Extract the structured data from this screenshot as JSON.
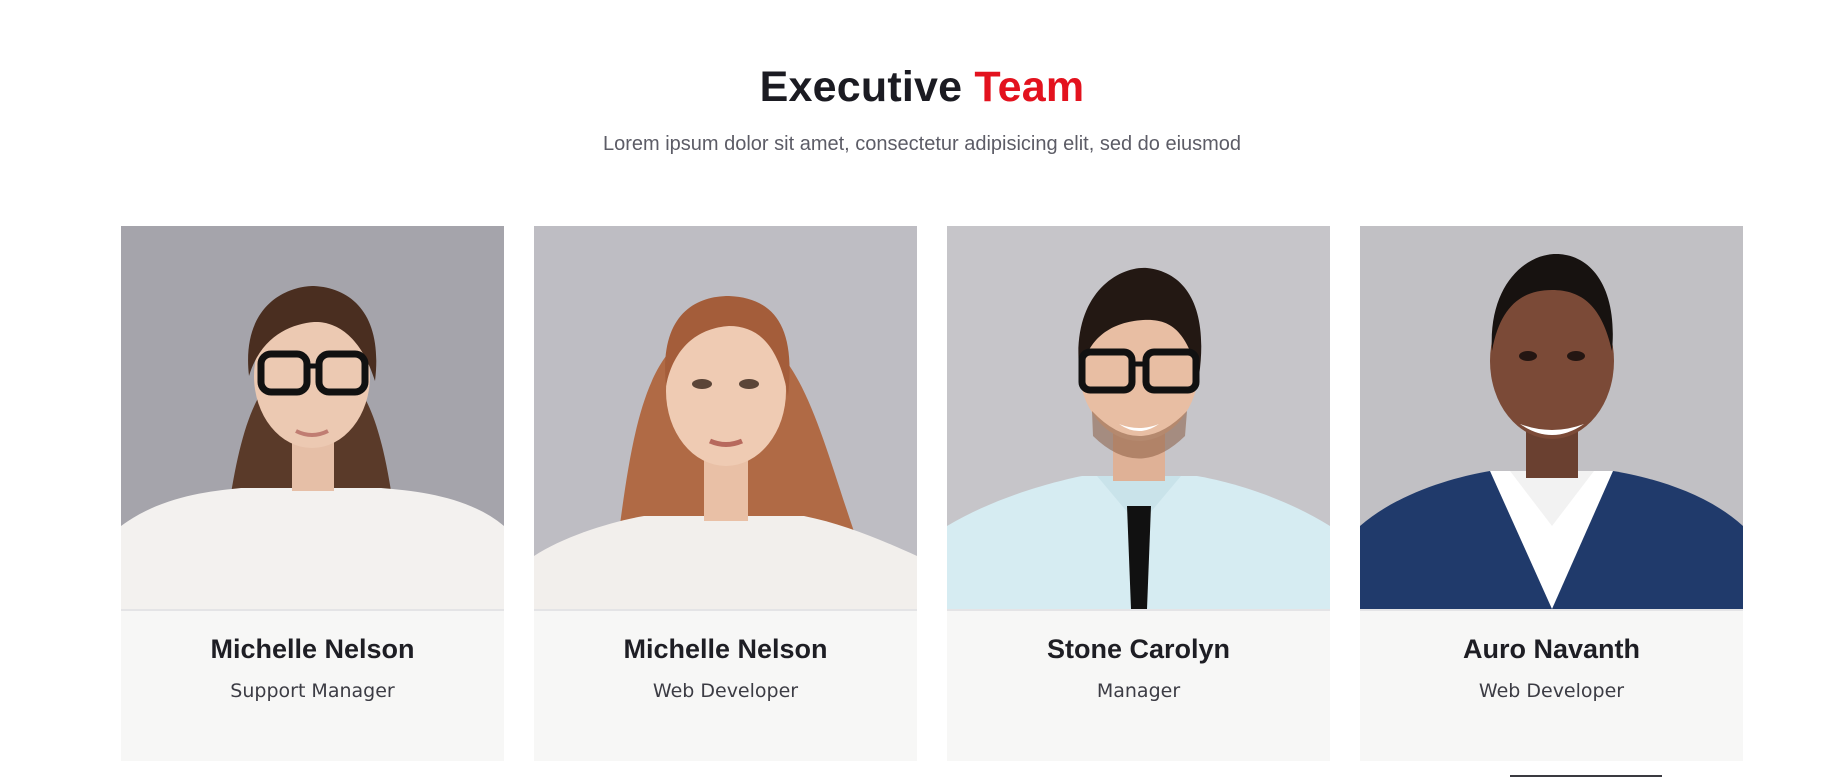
{
  "header": {
    "title_main": "Executive",
    "title_accent": "Team",
    "subtitle": "Lorem ipsum dolor sit amet, consectetur adipisicing elit, sed do eiusmod"
  },
  "team": [
    {
      "name": "Michelle Nelson",
      "role": "Support Manager"
    },
    {
      "name": "Michelle Nelson",
      "role": "Web Developer"
    },
    {
      "name": "Stone Carolyn",
      "role": "Manager"
    },
    {
      "name": "Auro Navanth",
      "role": "Web Developer"
    }
  ],
  "colors": {
    "accent": "#e3121e",
    "title": "#1b1b22",
    "card_background": "#f7f7f6"
  }
}
